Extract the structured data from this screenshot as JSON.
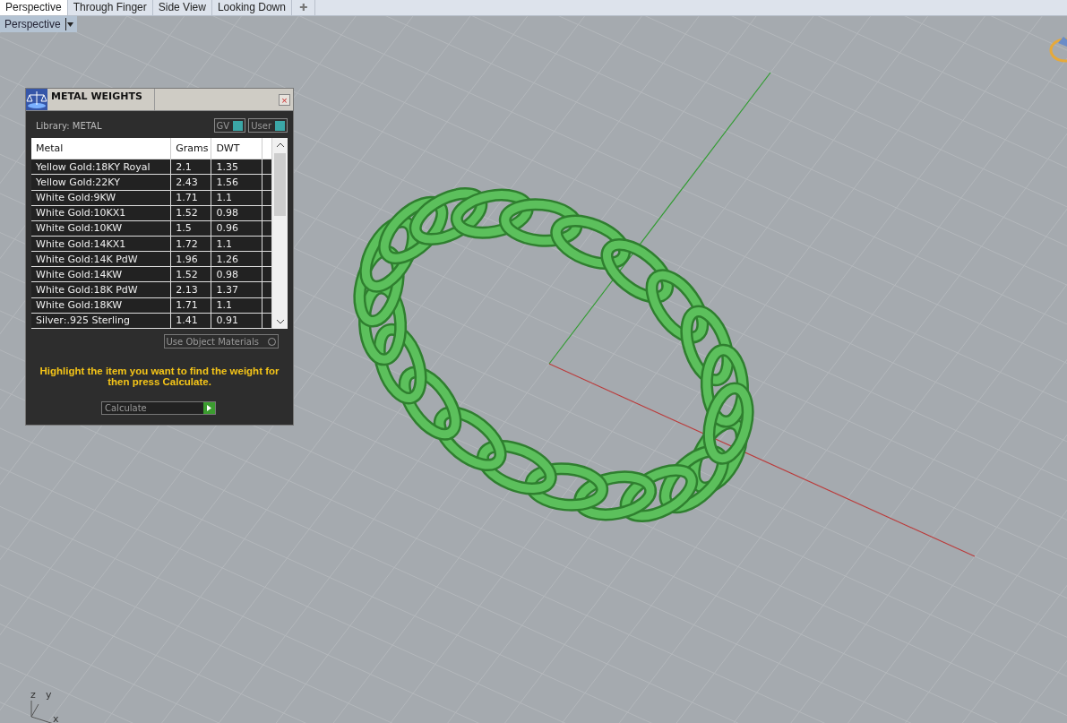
{
  "tabs": [
    {
      "label": "Perspective",
      "selected": true
    },
    {
      "label": "Through Finger",
      "selected": false
    },
    {
      "label": "Side View",
      "selected": false
    },
    {
      "label": "Looking Down",
      "selected": false
    }
  ],
  "add_tab": "✚",
  "viewport": {
    "label": "Perspective",
    "axis_labels": [
      "z",
      "y",
      "x"
    ]
  },
  "panel": {
    "title": "METAL WEIGHTS",
    "library": "Library: METAL",
    "close": "×",
    "toggles": [
      {
        "label": "GV",
        "on": true
      },
      {
        "label": "User",
        "on": true
      }
    ],
    "table": {
      "columns": [
        "Metal",
        "Grams",
        "DWT"
      ],
      "rows": [
        [
          "Yellow Gold:18KY Royal",
          "2.1",
          "1.35"
        ],
        [
          "Yellow Gold:22KY",
          "2.43",
          "1.56"
        ],
        [
          "White Gold:9KW",
          "1.71",
          "1.1"
        ],
        [
          "White Gold:10KX1",
          "1.52",
          "0.98"
        ],
        [
          "White Gold:10KW",
          "1.5",
          "0.96"
        ],
        [
          "White Gold:14KX1",
          "1.72",
          "1.1"
        ],
        [
          "White Gold:14K PdW",
          "1.96",
          "1.26"
        ],
        [
          "White Gold:14KW",
          "1.52",
          "0.98"
        ],
        [
          "White Gold:18K PdW",
          "2.13",
          "1.37"
        ],
        [
          "White Gold:18KW",
          "1.71",
          "1.1"
        ],
        [
          "Silver:.925 Sterling",
          "1.41",
          "0.91"
        ]
      ]
    },
    "use_object_materials": {
      "label": "Use Object Materials",
      "checked": false
    },
    "instruction": "Highlight the item you want to find the weight for then press Calculate.",
    "calculate": "Calculate"
  }
}
